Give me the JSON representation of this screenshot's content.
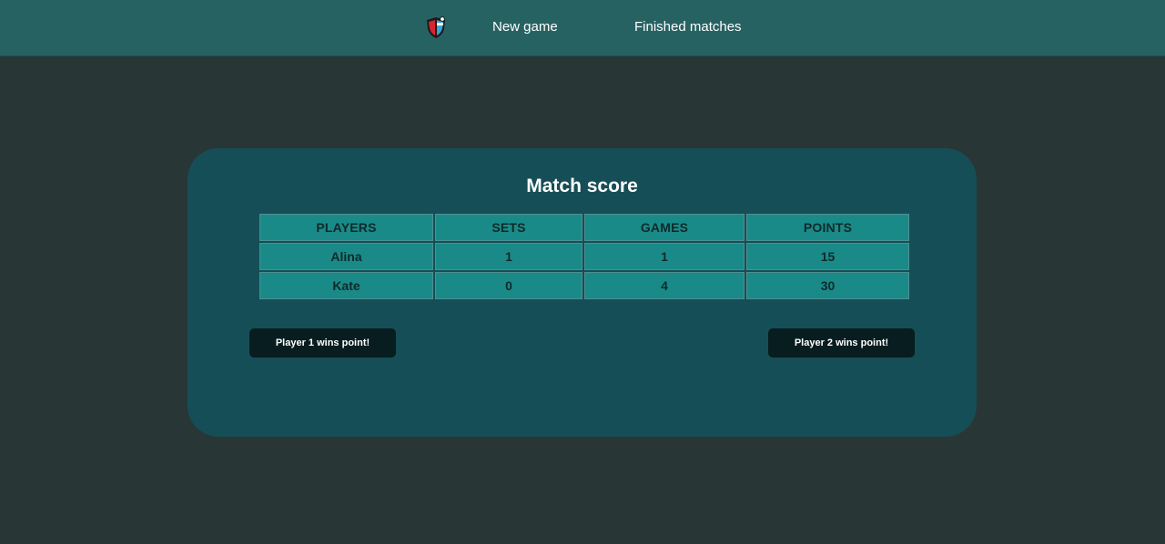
{
  "header": {
    "logo_icon": "tennis-shield-logo-icon",
    "nav": [
      {
        "label": "New game"
      },
      {
        "label": "Finished matches"
      }
    ]
  },
  "match": {
    "title": "Match score",
    "columns": [
      "PLAYERS",
      "SETS",
      "GAMES",
      "POINTS"
    ],
    "rows": [
      {
        "player": "Alina",
        "sets": "1",
        "games": "1",
        "points": "15"
      },
      {
        "player": "Kate",
        "sets": "0",
        "games": "4",
        "points": "30"
      }
    ],
    "buttons": {
      "player1": "Player 1 wins point!",
      "player2": "Player 2 wins point!"
    }
  },
  "colors": {
    "page_bg": "#283636",
    "header_bg": "#276263",
    "panel_bg": "#164e57",
    "cell_bg": "#1a8a88",
    "button_bg": "#071d1f"
  }
}
